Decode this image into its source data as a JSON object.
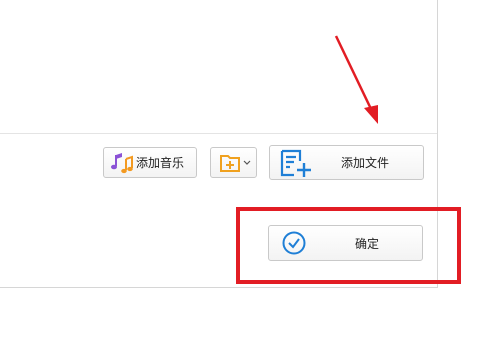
{
  "toolbar": {
    "add_music_label": "添加音乐",
    "add_file_label": "添加文件"
  },
  "footer": {
    "confirm_label": "确定"
  },
  "annotation": {
    "highlight_color": "#e21d24",
    "arrow_color": "#e21d24"
  },
  "icons": {
    "add_music": "music-note-icon",
    "add_folder": "add-folder-icon",
    "add_file": "add-file-icon",
    "confirm": "check-circle-icon",
    "dropdown": "chevron-down-icon"
  },
  "colors": {
    "accent_blue": "#1f7fd6",
    "folder_orange": "#f0a11f",
    "music_purple": "#8b52d6",
    "music_orange": "#f39a21"
  }
}
